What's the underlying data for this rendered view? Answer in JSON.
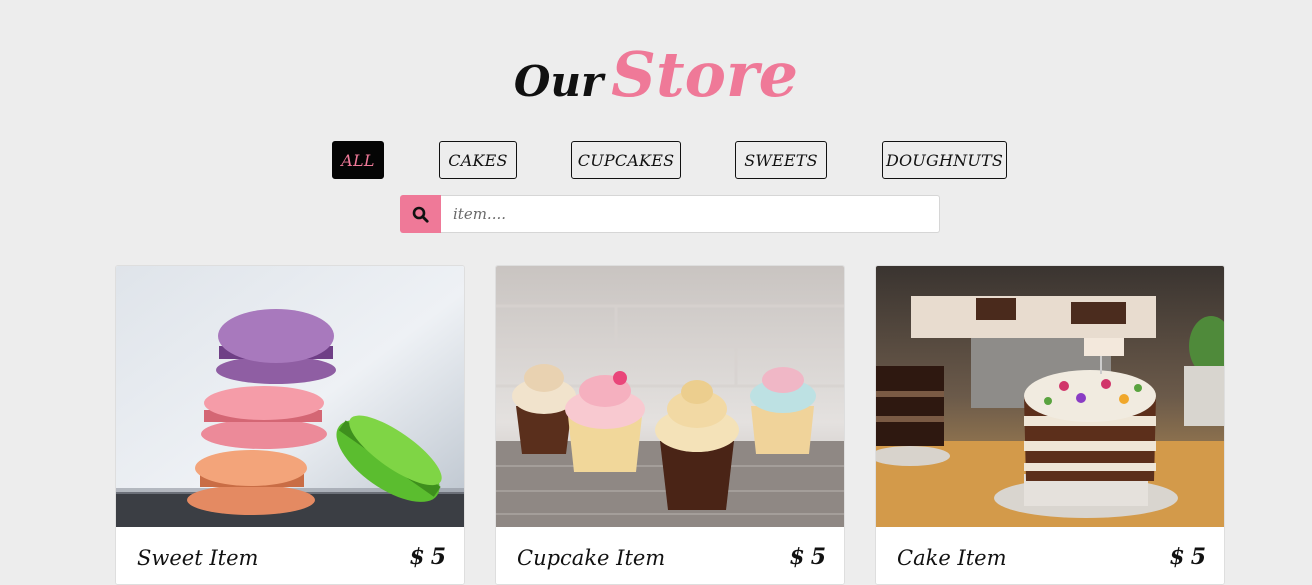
{
  "heading": {
    "word1": "Our",
    "word2": "Store"
  },
  "filters": [
    {
      "label": "ALL",
      "active": true
    },
    {
      "label": "CAKES",
      "active": false
    },
    {
      "label": "CUPCAKES",
      "active": false
    },
    {
      "label": "SWEETS",
      "active": false
    },
    {
      "label": "DOUGHNUTS",
      "active": false
    }
  ],
  "search": {
    "icon": "search-icon",
    "placeholder": "item...."
  },
  "products": [
    {
      "name": "Sweet Item",
      "currency": "$",
      "price": "5",
      "image": "macarons-photo"
    },
    {
      "name": "Cupcake Item",
      "currency": "$",
      "price": "5",
      "image": "cupcakes-photo"
    },
    {
      "name": "Cake Item",
      "currency": "$",
      "price": "5",
      "image": "cake-photo"
    }
  ],
  "colors": {
    "accent": "#ef7998",
    "background": "#ededed",
    "active_filter_bg": "#050505"
  }
}
